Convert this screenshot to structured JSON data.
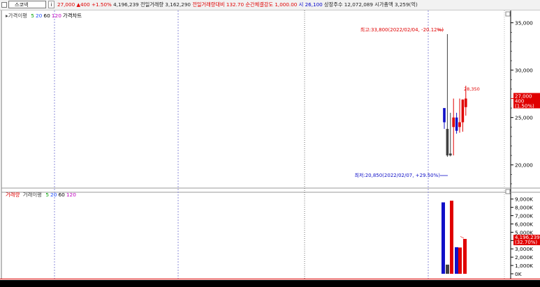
{
  "header": {
    "name_box": "스코넥",
    "info_button": "i",
    "price": "27,000",
    "change": "▲400",
    "change_pct": "+1.50%",
    "volume": "4,196,239",
    "prev_volume_label": "전일거래량",
    "prev_volume": "3,162,290",
    "prev_volume_ratio_label": "전일거래량대비",
    "prev_volume_ratio": "132.70",
    "exec_strength_label": "순간체결강도",
    "exec_strength": "1,000.00",
    "open_label": "시",
    "open": "26,100",
    "shares_label": "상장주수",
    "shares": "12,072,089",
    "market_cap_label": "시가총액",
    "market_cap": "3,259(억)"
  },
  "colors": {
    "up": "#e00000",
    "down": "#1010c8",
    "neutral": "#404040",
    "ma5": "#00a000",
    "ma20": "#2050ff",
    "ma60": "#000000",
    "ma120": "#c000c0",
    "grid_dash": "#8c8cd8",
    "grid_dot": "#9a9a9a",
    "axis": "#000000"
  },
  "chart_data": [
    {
      "type": "candlestick",
      "legend": [
        "가격이평",
        "5",
        "20",
        "60",
        "120",
        "가격차트"
      ],
      "y_ticks": [
        "35,000",
        "30,000",
        "25,000",
        "20,000"
      ],
      "ylim": [
        17700,
        36300
      ],
      "candles": [
        {
          "o": 24500,
          "h": 25500,
          "l": 23800,
          "c": 26000
        },
        {
          "o": 23800,
          "h": 33800,
          "l": 20850,
          "c": 21000
        },
        {
          "o": 21000,
          "h": 25500,
          "l": 20900,
          "c": 21200
        },
        {
          "o": 24000,
          "h": 27000,
          "l": 21000,
          "c": 25000
        },
        {
          "o": 23600,
          "h": 25500,
          "l": 23300,
          "c": 25000
        },
        {
          "o": 24500,
          "h": 27000,
          "l": 23400,
          "c": 24000
        },
        {
          "o": 24500,
          "h": 26900,
          "l": 23500,
          "c": 26900
        },
        {
          "o": 26100,
          "h": 28350,
          "l": 25200,
          "c": 27000
        }
      ],
      "candle_colors": [
        "down",
        "neutral",
        "neutral",
        "up",
        "down",
        "up",
        "up",
        "up"
      ],
      "annotations": {
        "high": "최고:33,800(2022/02/04, -20.12%)",
        "low": "최저:20,850(2022/02/07, +29.50%)",
        "last_high": "28,350"
      },
      "current": {
        "price": "27,000",
        "change": "400",
        "pct": "(1.50%)",
        "value": 27000
      }
    },
    {
      "type": "bar",
      "legend": [
        "거래량",
        "거래이평",
        "5",
        "20",
        "60",
        "120"
      ],
      "y_ticks": [
        "9,000K",
        "8,000K",
        "7,000K",
        "6,000K",
        "5,000K",
        "4,000K",
        "3,000K",
        "2,000K",
        "1,000K",
        "0K"
      ],
      "ylim": [
        0,
        9650000
      ],
      "values": [
        8600000,
        1100000,
        8800000,
        3200000,
        3162290,
        4196239
      ],
      "bar_colors": [
        "down",
        "neutral",
        "up",
        "down",
        "up",
        "up"
      ],
      "current": {
        "value": "4,196,239",
        "pct": "(32.70%)",
        "raw": 4196239
      }
    }
  ]
}
